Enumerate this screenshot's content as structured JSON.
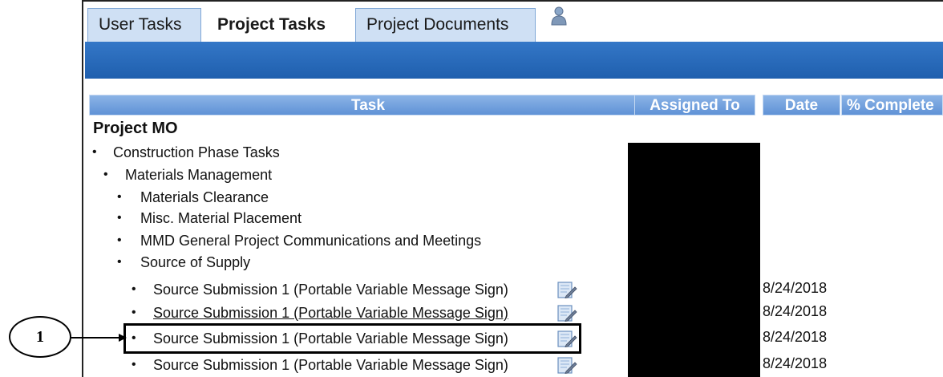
{
  "tabs": [
    {
      "label": "User Tasks",
      "active": false
    },
    {
      "label": "Project Tasks",
      "active": true
    },
    {
      "label": "Project Documents",
      "active": false
    }
  ],
  "table": {
    "headers": {
      "task": "Task",
      "assigned_to": "Assigned To",
      "date": "Date",
      "complete": "% Complete"
    }
  },
  "project": {
    "title": "Project MO",
    "tasks": [
      {
        "bullet": "•",
        "label": "Construction Phase Tasks"
      },
      {
        "bullet": "•",
        "label": "Materials Management"
      },
      {
        "bullet": "•",
        "label": "Materials Clearance"
      },
      {
        "bullet": "•",
        "label": "Misc. Material Placement"
      },
      {
        "bullet": "•",
        "label": "MMD General Project Communications and Meetings"
      },
      {
        "bullet": "•",
        "label": "Source of Supply"
      },
      {
        "bullet": "•",
        "label": "Source Submission 1 (Portable Variable Message Sign)",
        "date": "8/24/2018",
        "icon": "edit-document-icon"
      },
      {
        "bullet": "•",
        "label": "Source Submission 1 (Portable Variable Message Sign)",
        "date": "8/24/2018",
        "icon": "edit-document-icon"
      },
      {
        "bullet": "•",
        "label": "Source Submission 1 (Portable Variable Message Sign)",
        "date": "8/24/2018",
        "icon": "edit-document-icon"
      },
      {
        "bullet": "•",
        "label": "Source Submission 1 (Portable Variable Message Sign)",
        "date": "8/24/2018",
        "icon": "edit-document-icon"
      }
    ]
  },
  "callout": {
    "label": "1"
  },
  "colors": {
    "header_blue": "#1f5fae",
    "table_header": "#6f9fdc",
    "tab_inactive": "#cfe0f4"
  }
}
